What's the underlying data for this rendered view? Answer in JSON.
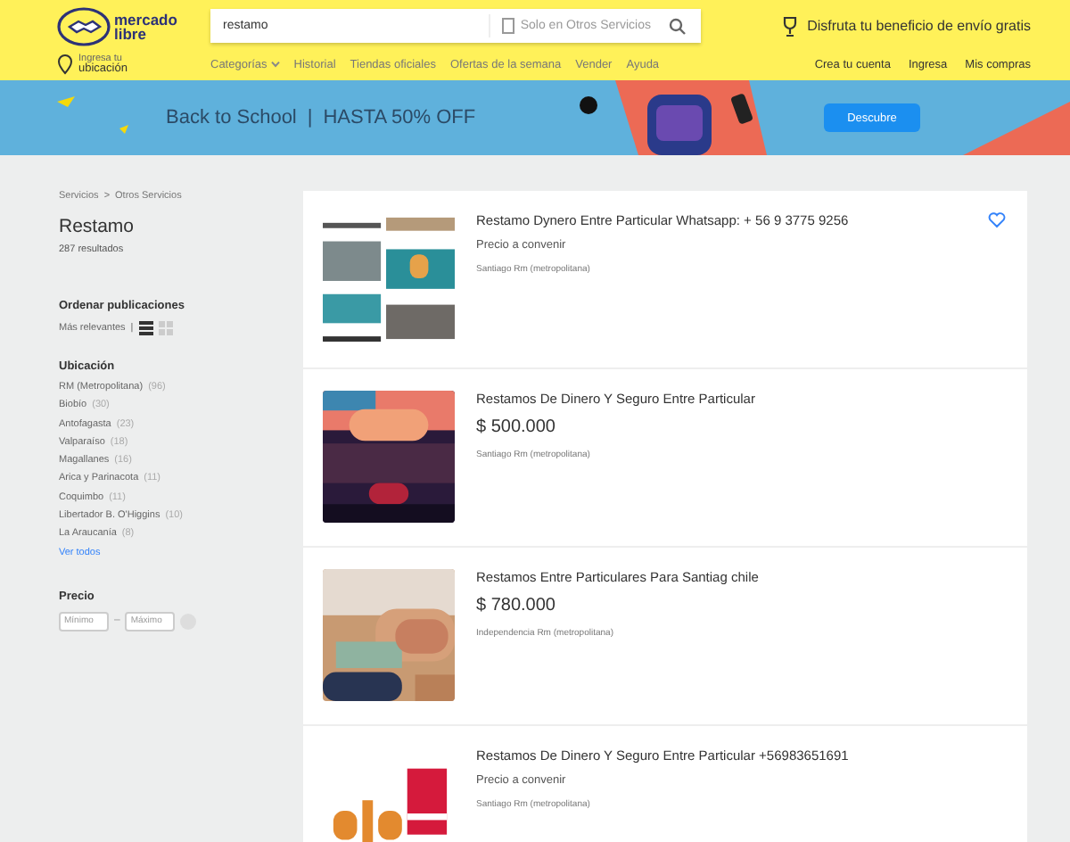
{
  "header": {
    "logo_line1": "mercado",
    "logo_line2": "libre",
    "search": {
      "value": "restamo",
      "scope": "Solo en Otros Servicios"
    },
    "promo": "Disfruta tu beneficio de envío gratis",
    "location": {
      "line1": "Ingresa tu",
      "line2": "ubicación"
    },
    "nav": [
      {
        "label": "Categorías",
        "dropdown": true
      },
      {
        "label": "Historial",
        "dropdown": false
      },
      {
        "label": "Tiendas oficiales",
        "dropdown": false
      },
      {
        "label": "Ofertas de la semana",
        "dropdown": false
      },
      {
        "label": "Vender",
        "dropdown": false
      },
      {
        "label": "Ayuda",
        "dropdown": false
      }
    ],
    "account": [
      "Crea tu cuenta",
      "Ingresa",
      "Mis compras"
    ]
  },
  "banner": {
    "title": "Back to School",
    "separator": "|",
    "offer": "HASTA 50% OFF",
    "button": "Descubre"
  },
  "sidebar": {
    "breadcrumb": [
      "Servicios",
      "Otros Servicios"
    ],
    "breadcrumb_sep": ">",
    "query": "Restamo",
    "results": "287 resultados",
    "sort_title": "Ordenar publicaciones",
    "sort_value": "Más relevantes",
    "sort_sep": "|",
    "views": [
      {
        "kind": "list",
        "selected": true
      },
      {
        "kind": "grid",
        "selected": false
      }
    ],
    "location_title": "Ubicación",
    "locations": [
      {
        "name": "RM (Metropolitana)",
        "count": "(96)"
      },
      {
        "name": "Biobío",
        "count": "(30)"
      },
      {
        "name": "Antofagasta",
        "count": "(23)"
      },
      {
        "name": "Valparaíso",
        "count": "(18)"
      },
      {
        "name": "Magallanes",
        "count": "(16)"
      },
      {
        "name": "Arica y Parinacota",
        "count": "(11)"
      },
      {
        "name": "Coquimbo",
        "count": "(11)"
      },
      {
        "name": "Libertador B. O'Higgins",
        "count": "(10)"
      },
      {
        "name": "La Araucanía",
        "count": "(8)"
      }
    ],
    "see_all": "Ver todos",
    "price_title": "Precio",
    "price_min": {
      "placeholder": "Mínimo"
    },
    "price_dash": "–",
    "price_max": {
      "placeholder": "Máximo"
    }
  },
  "results": [
    {
      "title": "Restamo Dynero Entre Particular Whatsapp: + 56 9 3775 9256",
      "kind": "agreed",
      "price": "Precio a convenir",
      "place": "Santiago Rm (metropolitana)",
      "hovered": true
    },
    {
      "title": "Restamos De Dinero Y Seguro Entre Particular",
      "kind": "amount",
      "price": "$ 500.000",
      "place": "Santiago Rm (metropolitana)",
      "hovered": false
    },
    {
      "title": "Restamos Entre Particulares Para Santiag chile",
      "kind": "amount",
      "price": "$ 780.000",
      "place": "Independencia Rm (metropolitana)",
      "hovered": false
    },
    {
      "title": "Restamos De Dinero Y Seguro Entre Particular +56983651691",
      "kind": "agreed",
      "price": "Precio a convenir",
      "place": "Santiago Rm (metropolitana)",
      "hovered": false
    }
  ]
}
